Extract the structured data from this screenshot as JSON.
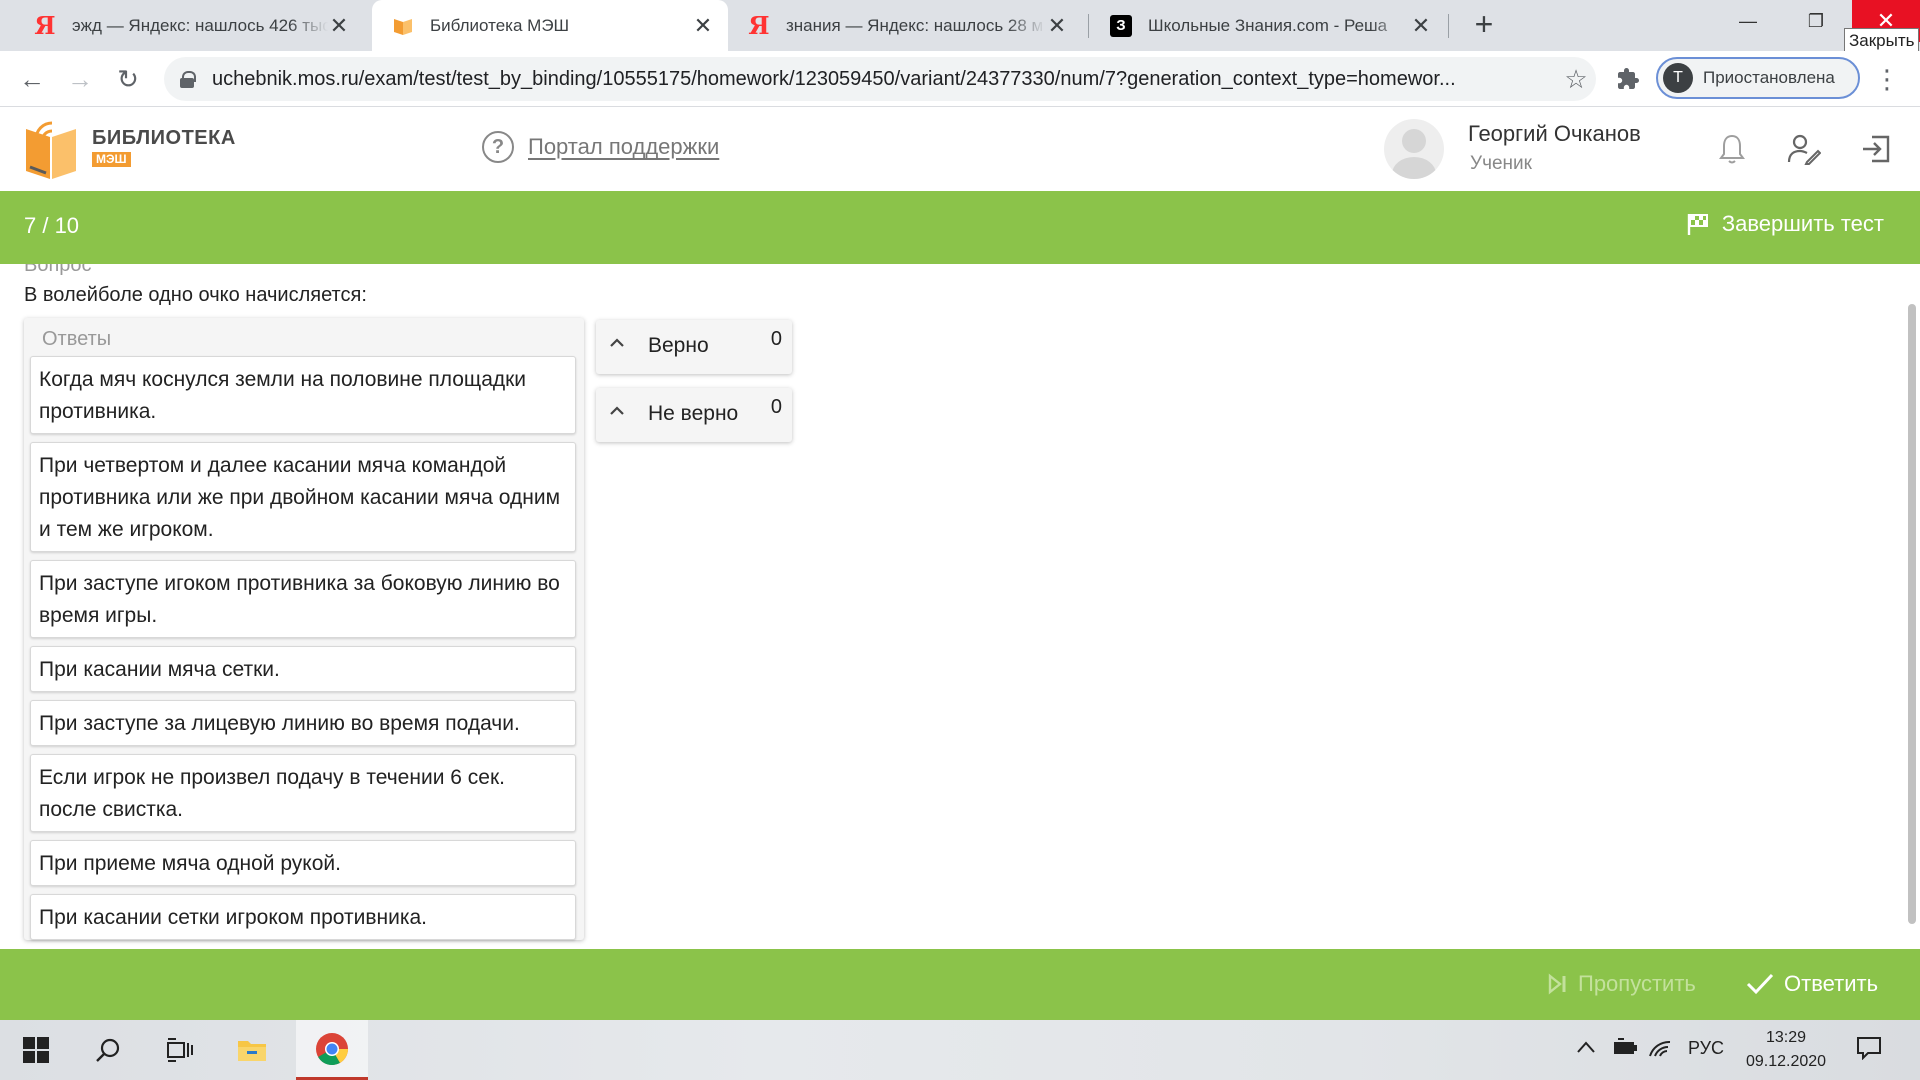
{
  "browser": {
    "tabs": [
      {
        "favicon": "yandex-icon",
        "title": "эжд — Яндекс: нашлось 426 тыс",
        "active": false
      },
      {
        "favicon": "book-icon",
        "title": "Библиотека МЭШ",
        "active": true
      },
      {
        "favicon": "yandex-icon",
        "title": "знания — Яндекс: нашлось 28 м",
        "active": false
      },
      {
        "favicon": "znanija-icon",
        "title": "Школьные Знания.com - Реша",
        "active": false
      }
    ],
    "close_tooltip": "Закрыть",
    "url": "uchebnik.mos.ru/exam/test/test_by_binding/10555175/homework/123059450/variant/24377330/num/7?generation_context_type=homewor...",
    "profile_initial": "T",
    "profile_label": "Приостановлена"
  },
  "header": {
    "logo_line1": "БИБЛИОТЕКА",
    "logo_line2": "МЭШ",
    "support_label": "Портал поддержки",
    "user_name": "Георгий Очканов",
    "user_role": "Ученик"
  },
  "progress": {
    "counter": "7 / 10",
    "finish_label": "Завершить тест"
  },
  "question": {
    "label": "Вопрос",
    "text": "В волейболе одно очко начисляется:",
    "answers_header": "Ответы",
    "answers": [
      "Когда мяч коснулся земли на половине площадки противника.",
      "При четвертом и далее касании мяча командой противника или же при двойном касании мяча одним и тем же игроком.",
      "При заступе игоком противника за боковую линию во время игры.",
      "При касании мяча сетки.",
      "При заступе за лицевую линию во время подачи.",
      "Если игрок не произвел подачу в течении 6 сек. после свистка.",
      "При приеме мяча одной рукой.",
      "При касании сетки игроком противника."
    ],
    "buckets": [
      {
        "label": "Верно",
        "count": "0"
      },
      {
        "label": "Не верно",
        "count": "0"
      }
    ]
  },
  "actions": {
    "skip_label": "Пропустить",
    "answer_label": "Ответить"
  },
  "taskbar": {
    "language": "РУС",
    "time": "13:29",
    "date": "09.12.2020"
  },
  "colors": {
    "accent_green": "#8bc34a",
    "logo_orange": "#f39c32",
    "close_red": "#e81123"
  }
}
